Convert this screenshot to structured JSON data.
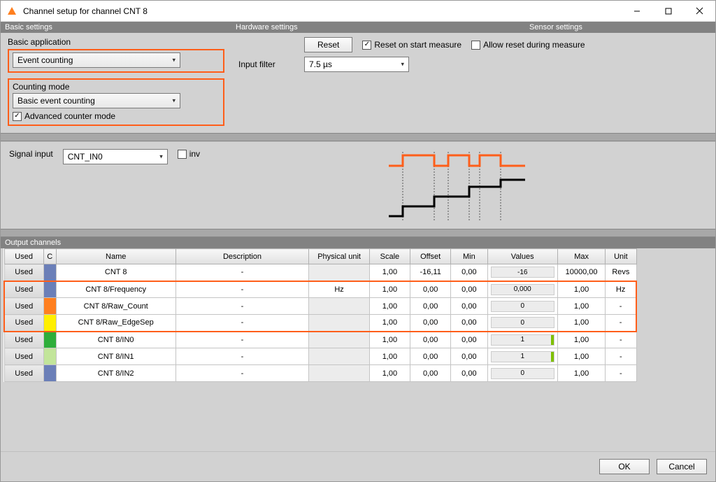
{
  "window": {
    "title": "Channel setup for channel CNT 8"
  },
  "sections": {
    "basic": "Basic settings",
    "hardware": "Hardware settings",
    "sensor": "Sensor settings",
    "output": "Output channels"
  },
  "basic": {
    "app_label": "Basic application",
    "app_value": "Event counting",
    "mode_label": "Counting mode",
    "mode_value": "Basic event counting",
    "advanced_label": "Advanced counter mode",
    "advanced_checked": true
  },
  "hardware": {
    "reset_btn": "Reset",
    "reset_on_start_label": "Reset on start measure",
    "reset_on_start_checked": true,
    "allow_reset_label": "Allow reset during measure",
    "allow_reset_checked": false,
    "input_filter_label": "Input filter",
    "input_filter_value": "7.5 µs"
  },
  "signal": {
    "label": "Signal input",
    "value": "CNT_IN0",
    "inv_label": "inv",
    "inv_checked": false
  },
  "table": {
    "headers": [
      "Used",
      "C",
      "Name",
      "Description",
      "Physical unit",
      "Scale",
      "Offset",
      "Min",
      "Values",
      "Max",
      "Unit"
    ],
    "rows": [
      {
        "used": "Used",
        "color": "#6b7fb8",
        "name": "CNT 8",
        "desc": "-",
        "punit": "",
        "punit_gray": true,
        "scale": "1,00",
        "offset": "-16,11",
        "min": "0,00",
        "val": "-16",
        "fill": 0,
        "max": "10000,00",
        "unit": "Revs",
        "hl": ""
      },
      {
        "used": "Used",
        "color": "#6b7fb8",
        "name": "CNT 8/Frequency",
        "desc": "-",
        "punit": "Hz",
        "punit_gray": false,
        "scale": "1,00",
        "offset": "0,00",
        "min": "0,00",
        "val": "0,000",
        "fill": 0,
        "max": "1,00",
        "unit": "Hz",
        "hl": "top"
      },
      {
        "used": "Used",
        "color": "#ff7f1f",
        "name": "CNT 8/Raw_Count",
        "desc": "-",
        "punit": "",
        "punit_gray": true,
        "scale": "1,00",
        "offset": "0,00",
        "min": "0,00",
        "val": "0",
        "fill": 0,
        "max": "1,00",
        "unit": "-",
        "hl": "mid"
      },
      {
        "used": "Used",
        "color": "#ffef00",
        "name": "CNT 8/Raw_EdgeSep",
        "desc": "-",
        "punit": "",
        "punit_gray": true,
        "scale": "1,00",
        "offset": "0,00",
        "min": "0,00",
        "val": "0",
        "fill": 0,
        "max": "1,00",
        "unit": "-",
        "hl": "bot"
      },
      {
        "used": "Used",
        "color": "#2eae3a",
        "name": "CNT 8/IN0",
        "desc": "-",
        "punit": "",
        "punit_gray": true,
        "scale": "1,00",
        "offset": "0,00",
        "min": "0,00",
        "val": "1",
        "fill": 100,
        "max": "1,00",
        "unit": "-",
        "hl": ""
      },
      {
        "used": "Used",
        "color": "#c2e59a",
        "name": "CNT 8/IN1",
        "desc": "-",
        "punit": "",
        "punit_gray": true,
        "scale": "1,00",
        "offset": "0,00",
        "min": "0,00",
        "val": "1",
        "fill": 100,
        "max": "1,00",
        "unit": "-",
        "hl": ""
      },
      {
        "used": "Used",
        "color": "#6b7fb8",
        "name": "CNT 8/IN2",
        "desc": "-",
        "punit": "",
        "punit_gray": true,
        "scale": "1,00",
        "offset": "0,00",
        "min": "0,00",
        "val": "0",
        "fill": 0,
        "max": "1,00",
        "unit": "-",
        "hl": ""
      }
    ]
  },
  "footer": {
    "ok": "OK",
    "cancel": "Cancel"
  }
}
